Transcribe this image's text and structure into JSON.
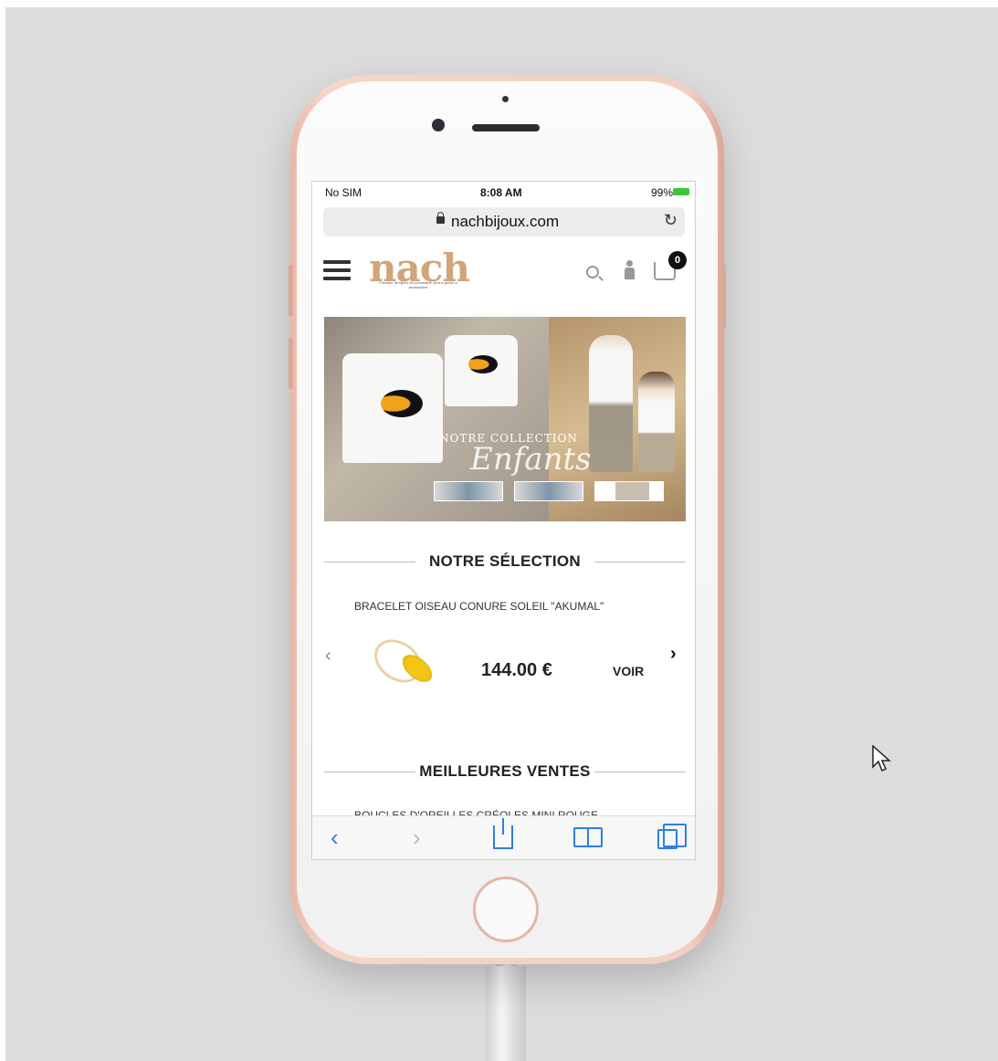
{
  "status_bar": {
    "carrier": "No SIM",
    "time": "8:08 AM",
    "battery": "99%"
  },
  "browser": {
    "url": "nachbijoux.com"
  },
  "site": {
    "logo": "nach",
    "tagline": "Créateur de bijoux en porcelaine, prêt-à-porter & accessoires",
    "cart_count": "0"
  },
  "banner": {
    "title": "NOTRE COLLECTION",
    "script": "Enfants"
  },
  "selection": {
    "heading": "NOTRE SÉLECTION",
    "product_name": "BRACELET OISEAU CONURE SOLEIL \"AKUMAL\"",
    "price": "144.00 €",
    "action": "VOIR",
    "prev": "‹",
    "next": "›"
  },
  "best_sellers": {
    "heading": "MEILLEURES VENTES",
    "product_name": "BOUCLES D'OREILLES CRÉOLES MINI ROUGE-"
  },
  "toolbar": {
    "back": "‹",
    "forward": "›"
  }
}
